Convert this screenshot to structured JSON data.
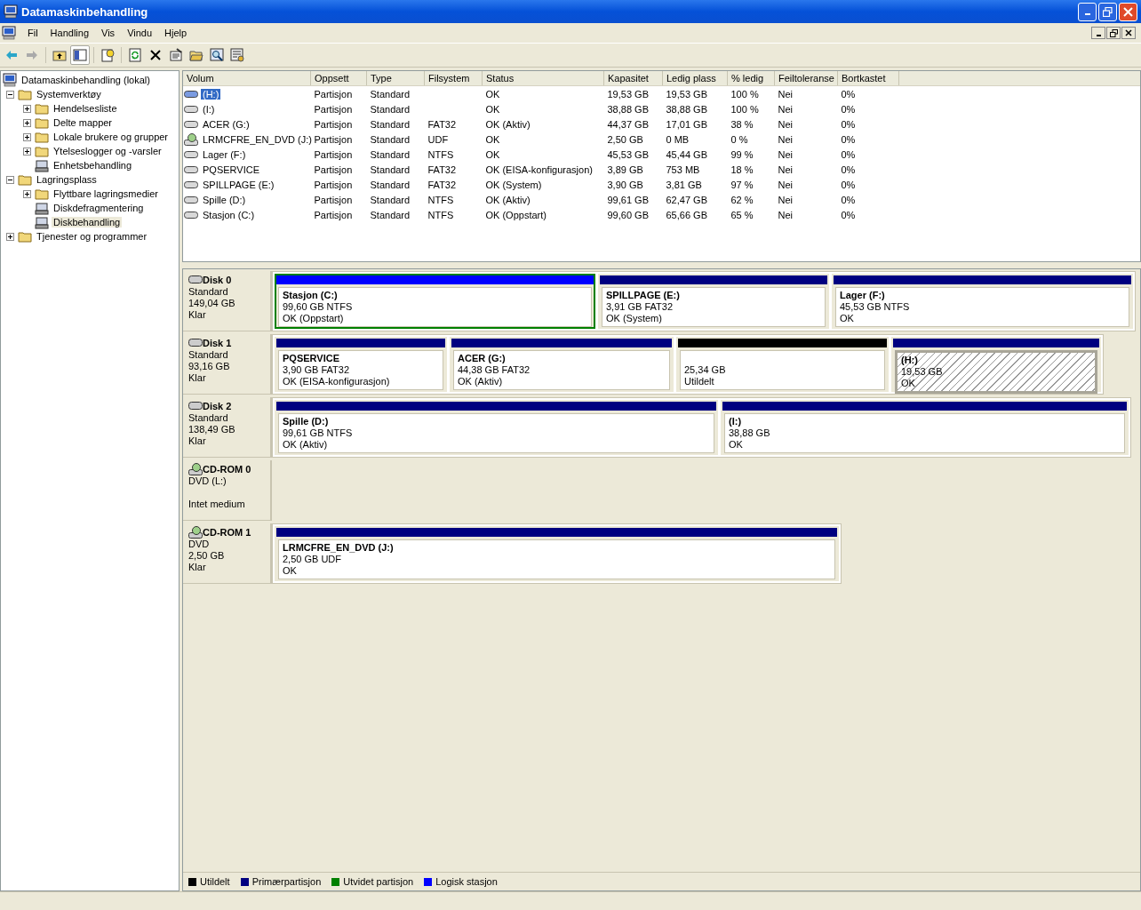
{
  "window": {
    "title": "Datamaskinbehandling"
  },
  "menu": [
    "Fil",
    "Handling",
    "Vis",
    "Vindu",
    "Hjelp"
  ],
  "tree": [
    {
      "label": "Datamaskinbehandling (lokal)",
      "selected": false,
      "children": [
        {
          "label": "Systemverktøy",
          "kind": "node",
          "expanded": true,
          "selected": false,
          "children": [
            {
              "label": "Hendelsesliste",
              "kind": "node",
              "expanded": false,
              "selected": false
            },
            {
              "label": "Delte mapper",
              "kind": "node",
              "expanded": false,
              "selected": false
            },
            {
              "label": "Lokale brukere og grupper",
              "kind": "node",
              "expanded": false,
              "selected": false
            },
            {
              "label": "Ytelseslogger og -varsler",
              "kind": "node",
              "expanded": false,
              "selected": false
            },
            {
              "label": "Enhetsbehandling",
              "kind": "leaf",
              "selected": false
            }
          ]
        },
        {
          "label": "Lagringsplass",
          "kind": "node",
          "expanded": true,
          "selected": false,
          "children": [
            {
              "label": "Flyttbare lagringsmedier",
              "kind": "node",
              "expanded": false,
              "selected": false
            },
            {
              "label": "Diskdefragmentering",
              "kind": "leaf",
              "selected": false
            },
            {
              "label": "Diskbehandling",
              "kind": "leaf",
              "selected": true
            }
          ]
        },
        {
          "label": "Tjenester og programmer",
          "kind": "node",
          "expanded": false,
          "selected": false
        }
      ]
    }
  ],
  "volumes": {
    "columns": [
      "Volum",
      "Oppsett",
      "Type",
      "Filsystem",
      "Status",
      "Kapasitet",
      "Ledig plass",
      "% ledig",
      "Feiltoleranse",
      "Bortkastet"
    ],
    "rows": [
      {
        "kind": "disk",
        "selected": true,
        "cells": [
          "(H:)",
          "Partisjon",
          "Standard",
          "",
          "OK",
          "19,53 GB",
          "19,53 GB",
          "100 %",
          "Nei",
          "0%"
        ]
      },
      {
        "kind": "disk",
        "selected": false,
        "cells": [
          "(I:)",
          "Partisjon",
          "Standard",
          "",
          "OK",
          "38,88 GB",
          "38,88 GB",
          "100 %",
          "Nei",
          "0%"
        ]
      },
      {
        "kind": "disk",
        "selected": false,
        "cells": [
          "ACER (G:)",
          "Partisjon",
          "Standard",
          "FAT32",
          "OK (Aktiv)",
          "44,37 GB",
          "17,01 GB",
          "38 %",
          "Nei",
          "0%"
        ]
      },
      {
        "kind": "cdrom",
        "selected": false,
        "cells": [
          "LRMCFRE_EN_DVD (J:)",
          "Partisjon",
          "Standard",
          "UDF",
          "OK",
          "2,50 GB",
          "0 MB",
          "0 %",
          "Nei",
          "0%"
        ]
      },
      {
        "kind": "disk",
        "selected": false,
        "cells": [
          "Lager (F:)",
          "Partisjon",
          "Standard",
          "NTFS",
          "OK",
          "45,53 GB",
          "45,44 GB",
          "99 %",
          "Nei",
          "0%"
        ]
      },
      {
        "kind": "disk",
        "selected": false,
        "cells": [
          "PQSERVICE",
          "Partisjon",
          "Standard",
          "FAT32",
          "OK (EISA-konfigurasjon)",
          "3,89 GB",
          "753 MB",
          "18 %",
          "Nei",
          "0%"
        ]
      },
      {
        "kind": "disk",
        "selected": false,
        "cells": [
          "SPILLPAGE (E:)",
          "Partisjon",
          "Standard",
          "FAT32",
          "OK (System)",
          "3,90 GB",
          "3,81 GB",
          "97 %",
          "Nei",
          "0%"
        ]
      },
      {
        "kind": "disk",
        "selected": false,
        "cells": [
          "Spille (D:)",
          "Partisjon",
          "Standard",
          "NTFS",
          "OK (Aktiv)",
          "99,61 GB",
          "62,47 GB",
          "62 %",
          "Nei",
          "0%"
        ]
      },
      {
        "kind": "disk",
        "selected": false,
        "cells": [
          "Stasjon (C:)",
          "Partisjon",
          "Standard",
          "NTFS",
          "OK (Oppstart)",
          "99,60 GB",
          "65,66 GB",
          "65 %",
          "Nei",
          "0%"
        ]
      }
    ]
  },
  "disks": [
    {
      "kind": "disk",
      "name": "Disk 0",
      "lines": [
        "Standard",
        "149,04 GB",
        "Klar"
      ],
      "partitions": [
        {
          "kind": "logical",
          "extended": true,
          "selected": false,
          "name": "Stasjon  (C:)",
          "size": "99,60 GB NTFS",
          "status": "OK (Oppstart)"
        },
        {
          "kind": "primary",
          "extended": false,
          "selected": false,
          "name": "SPILLPAGE  (E:)",
          "size": "3,91 GB FAT32",
          "status": "OK (System)"
        },
        {
          "kind": "primary",
          "extended": false,
          "selected": false,
          "name": "Lager  (F:)",
          "size": "45,53 GB NTFS",
          "status": "OK"
        }
      ]
    },
    {
      "kind": "disk",
      "name": "Disk 1",
      "lines": [
        "Standard",
        "93,16 GB",
        "Klar"
      ],
      "partitions": [
        {
          "kind": "primary",
          "extended": false,
          "selected": false,
          "name": "PQSERVICE",
          "size": "3,90 GB FAT32",
          "status": "OK (EISA-konfigurasjon)"
        },
        {
          "kind": "primary",
          "extended": false,
          "selected": false,
          "name": "ACER  (G:)",
          "size": "44,38 GB FAT32",
          "status": "OK (Aktiv)"
        },
        {
          "kind": "unallocated",
          "extended": false,
          "selected": false,
          "size": "25,34 GB",
          "status": "Utildelt"
        },
        {
          "kind": "primary",
          "extended": false,
          "selected": true,
          "name": "(H:)",
          "size": "19,53 GB",
          "status": "OK"
        }
      ]
    },
    {
      "kind": "disk",
      "name": "Disk 2",
      "lines": [
        "Standard",
        "138,49 GB",
        "Klar"
      ],
      "partitions": [
        {
          "kind": "primary",
          "extended": false,
          "selected": false,
          "name": "Spille  (D:)",
          "size": "99,61 GB NTFS",
          "status": "OK (Aktiv)"
        },
        {
          "kind": "primary",
          "extended": false,
          "selected": false,
          "name": "(I:)",
          "size": "38,88 GB",
          "status": "OK"
        }
      ]
    },
    {
      "kind": "cdrom",
      "name": "CD-ROM 0",
      "lines": [
        "DVD (L:)",
        "Intet medium"
      ]
    },
    {
      "kind": "cdrom",
      "name": "CD-ROM 1",
      "lines": [
        "DVD",
        "2,50 GB",
        "Klar"
      ],
      "partitions": [
        {
          "kind": "primary",
          "extended": false,
          "selected": false,
          "name": "LRMCFRE_EN_DVD  (J:)",
          "size": "2,50 GB UDF",
          "status": "OK"
        }
      ]
    }
  ],
  "legend": [
    {
      "label": "Utildelt",
      "color": "#000000"
    },
    {
      "label": "Primærpartisjon",
      "color": "#000080"
    },
    {
      "label": "Utvidet partisjon",
      "color": "#008000"
    },
    {
      "label": "Logisk stasjon",
      "color": "#0000ff"
    }
  ]
}
